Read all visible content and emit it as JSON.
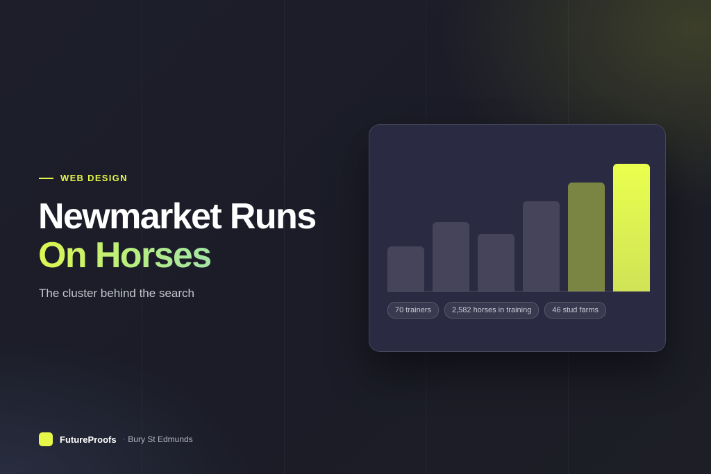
{
  "eyebrow": "WEB DESIGN",
  "title": {
    "line1": "Newmarket Runs",
    "line2": "On Horses"
  },
  "subtitle": "The cluster behind the search",
  "chart_data": {
    "type": "bar",
    "values": [
      12,
      18.5,
      15.3,
      24,
      29,
      34
    ],
    "colors": [
      "#45445a",
      "#45445a",
      "#45445a",
      "#45445a",
      "#7b8543",
      "gradient-lime"
    ],
    "ylim": [
      0,
      37
    ]
  },
  "stats": [
    "70 trainers",
    "2,582 horses in training",
    "46 stud farms"
  ],
  "footer": {
    "brand": "FutureProofs",
    "separator": "·",
    "location": "Bury St Edmunds"
  },
  "colors": {
    "accent": "#e6f74a",
    "background": "#1d1e2a",
    "card": "#2a2b42"
  }
}
